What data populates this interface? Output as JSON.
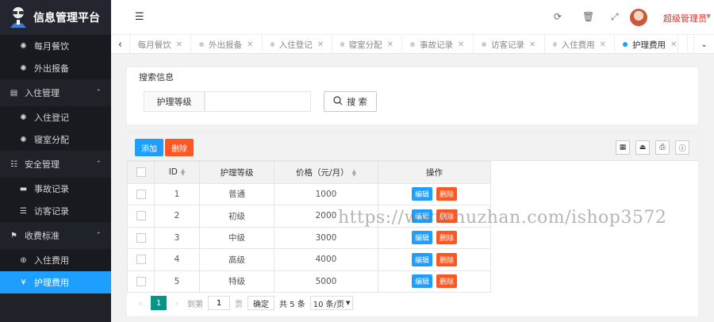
{
  "app": {
    "title": "信息管理平台"
  },
  "sidebar": {
    "items": [
      {
        "type": "sub",
        "label": "每月餐饮",
        "icon": "gear-icon"
      },
      {
        "type": "sub",
        "label": "外出报备",
        "icon": "gear-icon"
      },
      {
        "type": "group",
        "label": "入住管理",
        "icon": "document-icon"
      },
      {
        "type": "sub",
        "label": "入住登记",
        "icon": "gear-icon"
      },
      {
        "type": "sub",
        "label": "寝室分配",
        "icon": "gear-icon"
      },
      {
        "type": "group",
        "label": "安全管理",
        "icon": "calendar-icon"
      },
      {
        "type": "sub",
        "label": "事故记录",
        "icon": "card-icon"
      },
      {
        "type": "sub",
        "label": "访客记录",
        "icon": "list-icon"
      },
      {
        "type": "group",
        "label": "收费标准",
        "icon": "flag-icon"
      },
      {
        "type": "sub",
        "label": "入住费用",
        "icon": "plus-circle-icon"
      },
      {
        "type": "sub",
        "label": "护理费用",
        "icon": "yen-icon",
        "active": true
      }
    ]
  },
  "header": {
    "user_name": "超级管理员"
  },
  "tabs": [
    {
      "label": "每月餐饮",
      "active": false
    },
    {
      "label": "外出报备",
      "active": false
    },
    {
      "label": "入住登记",
      "active": false
    },
    {
      "label": "寝室分配",
      "active": false
    },
    {
      "label": "事故记录",
      "active": false
    },
    {
      "label": "访客记录",
      "active": false
    },
    {
      "label": "入住费用",
      "active": false
    },
    {
      "label": "护理费用",
      "active": true
    }
  ],
  "search": {
    "title": "搜索信息",
    "field_label": "护理等级",
    "input_value": "",
    "button_label": "搜 索"
  },
  "toolbar": {
    "add_label": "添加",
    "delete_label": "删除"
  },
  "table": {
    "columns": [
      "ID",
      "护理等级",
      "价格（元/月）",
      "操作"
    ],
    "edit_label": "编辑",
    "delete_label": "删除",
    "rows": [
      {
        "id": "1",
        "level": "普通",
        "price": "1000"
      },
      {
        "id": "2",
        "level": "初级",
        "price": "2000"
      },
      {
        "id": "3",
        "level": "中级",
        "price": "3000"
      },
      {
        "id": "4",
        "level": "高级",
        "price": "4000"
      },
      {
        "id": "5",
        "level": "特级",
        "price": "5000"
      }
    ]
  },
  "pager": {
    "current": "1",
    "goto_prefix": "到第",
    "goto_value": "1",
    "goto_suffix": "页",
    "confirm_label": "确定",
    "total_text": "共 5 条",
    "page_size": "10 条/页"
  },
  "watermark": "https://www.huzhan.com/ishop3572",
  "colors": {
    "accent": "#1e9fff",
    "danger": "#ff5722",
    "sidebar_bg": "#20222a",
    "pager_active": "#009688",
    "user_name": "#d9302c"
  }
}
